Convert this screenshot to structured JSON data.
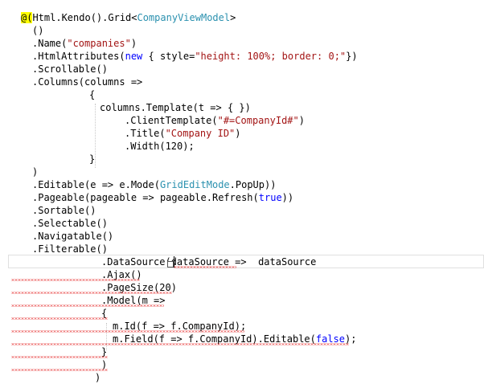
{
  "lines": [
    {
      "segments": [
        {
          "t": "@(",
          "c": "razor"
        },
        {
          "t": "Html.Kendo().Grid<"
        },
        {
          "t": "CompanyViewModel",
          "c": "teal"
        },
        {
          "t": ">"
        }
      ]
    },
    {
      "segments": [
        {
          "t": "()"
        }
      ]
    },
    {
      "segments": [
        {
          "t": ".Name("
        },
        {
          "t": "\"companies\"",
          "c": "red"
        },
        {
          "t": ")"
        }
      ]
    },
    {
      "segments": [
        {
          "t": ".HtmlAttributes("
        },
        {
          "t": "new",
          "c": "blue"
        },
        {
          "t": " { style="
        },
        {
          "t": "\"height: 100%; border: 0;\"",
          "c": "red"
        },
        {
          "t": "})"
        }
      ]
    },
    {
      "segments": [
        {
          "t": ".Scrollable()"
        }
      ]
    },
    {
      "segments": [
        {
          "t": ".Columns(columns =>"
        }
      ]
    },
    {
      "segments": [
        {
          "t": "{"
        }
      ]
    },
    {
      "segments": [
        {
          "t": "columns.Template(t => { })"
        }
      ]
    },
    {
      "segments": [
        {
          "t": ".ClientTemplate("
        },
        {
          "t": "\"#=CompanyId#\"",
          "c": "red"
        },
        {
          "t": ")"
        }
      ]
    },
    {
      "segments": [
        {
          "t": ".Title("
        },
        {
          "t": "\"Company ID\"",
          "c": "red"
        },
        {
          "t": ")"
        }
      ]
    },
    {
      "segments": [
        {
          "t": ".Width(120);"
        }
      ]
    },
    {
      "segments": [
        {
          "t": "}"
        }
      ]
    },
    {
      "segments": [
        {
          "t": ")"
        }
      ]
    },
    {
      "segments": [
        {
          "t": ".Editable(e => e.Mode("
        },
        {
          "t": "GridEditMode",
          "c": "teal"
        },
        {
          "t": ".PopUp))"
        }
      ]
    },
    {
      "segments": [
        {
          "t": ".Pageable(pageable => pageable.Refresh("
        },
        {
          "t": "true",
          "c": "blue"
        },
        {
          "t": "))"
        }
      ]
    },
    {
      "segments": [
        {
          "t": ".Sortable()"
        }
      ]
    },
    {
      "segments": [
        {
          "t": ".Selectable()"
        }
      ]
    },
    {
      "segments": [
        {
          "t": ".Navigatable()"
        }
      ]
    },
    {
      "segments": [
        {
          "t": ".Filterable()"
        }
      ]
    },
    {
      "segments": [
        {
          "t": ".DataSource(dataSource =>  dataSource"
        }
      ]
    },
    {
      "segments": [
        {
          "t": ".Ajax()"
        }
      ]
    },
    {
      "segments": [
        {
          "t": ".PageSize(20)"
        }
      ]
    },
    {
      "segments": [
        {
          "t": ".Model(m =>"
        }
      ]
    },
    {
      "segments": [
        {
          "t": "{"
        }
      ]
    },
    {
      "segments": [
        {
          "t": "m.Id(f => f.CompanyId);"
        }
      ]
    },
    {
      "segments": [
        {
          "t": "m.Field(f => f.CompanyId).Editable("
        },
        {
          "t": "false",
          "c": "blue"
        },
        {
          "t": ");"
        }
      ]
    },
    {
      "segments": [
        {
          "t": "}"
        }
      ]
    },
    {
      "segments": [
        {
          "t": ")"
        }
      ]
    },
    {
      "segments": [
        {
          "t": ")"
        }
      ]
    }
  ],
  "colors": {
    "keyword": "#0000ff",
    "type": "#2b91af",
    "string": "#a31515",
    "razor_highlight": "#ffff00",
    "error_squiggle": "#e00000"
  }
}
